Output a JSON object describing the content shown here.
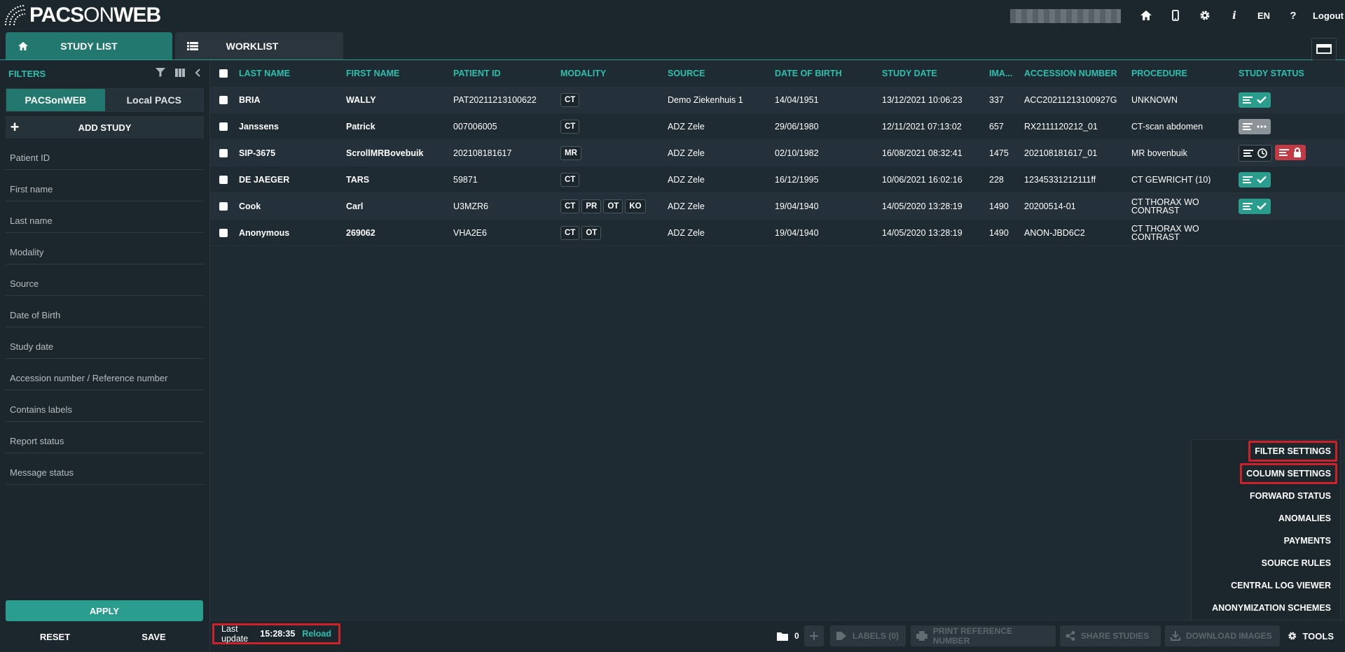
{
  "app": {
    "logo_a": "PACS",
    "logo_b": "ON",
    "logo_c": "WEB"
  },
  "header": {
    "lang": "EN",
    "help": "?",
    "info": "i",
    "logout": "Logout"
  },
  "tabs": [
    {
      "label": "STUDY LIST"
    },
    {
      "label": "WORKLIST"
    }
  ],
  "sidebar": {
    "title": "FILTERS",
    "sources": [
      "PACSonWEB",
      "Local PACS"
    ],
    "add_study": "ADD STUDY",
    "fields": [
      "Patient ID",
      "First name",
      "Last name",
      "Modality",
      "Source",
      "Date of Birth",
      "Study date",
      "Accession number / Reference number",
      "Contains labels",
      "Report status",
      "Message status"
    ],
    "apply": "APPLY",
    "reset": "RESET",
    "save": "SAVE"
  },
  "table": {
    "columns": [
      "LAST NAME",
      "FIRST NAME",
      "PATIENT ID",
      "MODALITY",
      "SOURCE",
      "DATE OF BIRTH",
      "STUDY DATE",
      "IMA...",
      "ACCESSION NUMBER",
      "PROCEDURE",
      "STUDY STATUS"
    ],
    "rows": [
      {
        "last": "BRIA",
        "first": "WALLY",
        "pid": "PAT20211213100622",
        "mod": [
          "CT"
        ],
        "src": "Demo Ziekenhuis 1",
        "dob": "14/04/1951",
        "sd": "13/12/2021 10:06:23",
        "img": "337",
        "acc": "ACC20211213100927G",
        "proc": "UNKNOWN",
        "status": "green"
      },
      {
        "last": "Janssens",
        "first": "Patrick",
        "pid": "007006005",
        "mod": [
          "CT"
        ],
        "src": "ADZ Zele",
        "dob": "29/06/1980",
        "sd": "12/11/2021 07:13:02",
        "img": "657",
        "acc": "RX2111120212_01",
        "proc": "CT-scan abdomen",
        "status": "grey"
      },
      {
        "last": "SIP-3675",
        "first": "ScrollMRBovebuik",
        "pid": "202108181617",
        "mod": [
          "MR"
        ],
        "src": "ADZ Zele",
        "dob": "02/10/1982",
        "sd": "16/08/2021 08:32:41",
        "img": "1475",
        "acc": "202108181617_01",
        "proc": "MR bovenbuik",
        "status": "locked"
      },
      {
        "last": "DE JAEGER",
        "first": "TARS",
        "pid": "59871",
        "mod": [
          "CT"
        ],
        "src": "ADZ Zele",
        "dob": "16/12/1995",
        "sd": "10/06/2021 16:02:16",
        "img": "228",
        "acc": "12345331212111ff",
        "proc": "CT GEWRICHT (10)",
        "status": "green"
      },
      {
        "last": "Cook",
        "first": "Carl",
        "pid": "U3MZR6",
        "mod": [
          "CT",
          "PR",
          "OT",
          "KO"
        ],
        "src": "ADZ Zele",
        "dob": "19/04/1940",
        "sd": "14/05/2020 13:28:19",
        "img": "1490",
        "acc": "20200514-01",
        "proc": "CT THORAX WO CONTRAST",
        "status": "green"
      },
      {
        "last": "Anonymous",
        "first": "269062",
        "pid": "VHA2E6",
        "mod": [
          "CT",
          "OT"
        ],
        "src": "ADZ Zele",
        "dob": "19/04/1940",
        "sd": "14/05/2020 13:28:19",
        "img": "1490",
        "acc": "ANON-JBD6C2",
        "proc": "CT THORAX WO CONTRAST",
        "status": "none"
      }
    ]
  },
  "tools_menu": [
    "FILTER SETTINGS",
    "COLUMN SETTINGS",
    "FORWARD STATUS",
    "ANOMALIES",
    "PAYMENTS",
    "SOURCE RULES",
    "CENTRAL LOG VIEWER",
    "ANONYMIZATION SCHEMES"
  ],
  "bottom": {
    "last_update_label": "Last update",
    "last_update_time": "15:28:35",
    "reload": "Reload",
    "folder_count": "0",
    "labels": "LABELS (0)",
    "print_ref": "PRINT REFERENCE NUMBER",
    "share": "SHARE STUDIES",
    "download": "DOWNLOAD IMAGES",
    "tools": "TOOLS"
  },
  "colors": {
    "accent": "#2ebfae",
    "tab_active": "#22786e",
    "highlight": "#d0202a"
  }
}
